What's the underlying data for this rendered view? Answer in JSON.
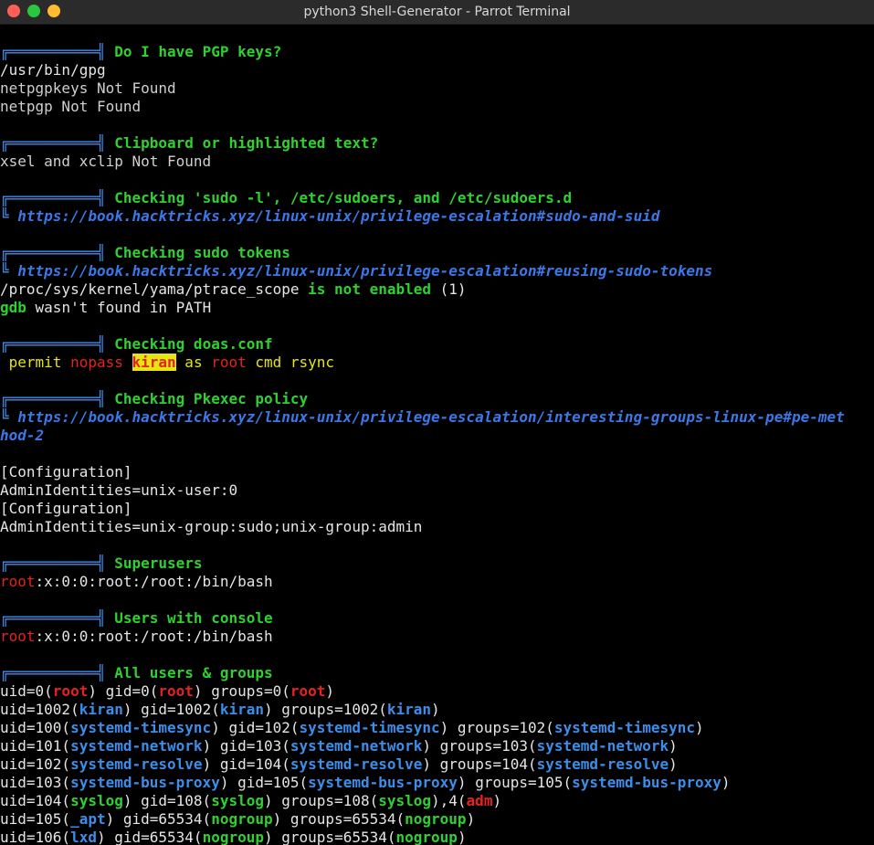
{
  "window": {
    "title": "python3 Shell-Generator - Parrot Terminal"
  },
  "banner": "╔══════════╣ ",
  "sub": "╚ ",
  "sections": {
    "pgp": {
      "title": "Do I have PGP keys?",
      "lines": [
        "/usr/bin/gpg",
        "netpgpkeys Not Found",
        "netpgp Not Found"
      ]
    },
    "clipboard": {
      "title": "Clipboard or highlighted text?",
      "lines": [
        "xsel and xclip Not Found"
      ]
    },
    "sudo": {
      "title": "Checking 'sudo -l', /etc/sudoers, and /etc/sudoers.d",
      "url": "https://book.hacktricks.xyz/linux-unix/privilege-escalation#sudo-and-suid"
    },
    "tokens": {
      "title": "Checking sudo tokens",
      "url": "https://book.hacktricks.xyz/linux-unix/privilege-escalation#reusing-sudo-tokens",
      "ptrace_path": "/proc/sys/kernel/yama/ptrace_scope",
      "ptrace_status": " is not enabled",
      "ptrace_value": " (1)",
      "gdb": "gdb",
      "gdb_rest": " wasn't found in PATH"
    },
    "doas": {
      "title": "Checking doas.conf",
      "permit": " permit ",
      "nopass": "nopass",
      "space": " ",
      "user": "kiran",
      "as": " as ",
      "root": "root",
      "rest": " cmd rsync"
    },
    "pkexec": {
      "title": "Checking Pkexec policy",
      "url1": "https://book.hacktricks.xyz/linux-unix/privilege-escalation/interesting-groups-linux-pe#pe-met",
      "url2": "hod-2",
      "lines": [
        "[Configuration]",
        "AdminIdentities=unix-user:0",
        "[Configuration]",
        "AdminIdentities=unix-group:sudo;unix-group:admin"
      ]
    },
    "superusers": {
      "title": "Superusers",
      "root": "root",
      "rest": ":x:0:0:root:/root:/bin/bash"
    },
    "console": {
      "title": "Users with console",
      "root": "root",
      "rest": ":x:0:0:root:/root:/bin/bash"
    },
    "allusers": {
      "title": "All users & groups"
    }
  },
  "users": [
    [
      [
        "uid=0(",
        ""
      ],
      [
        "root",
        "r"
      ],
      [
        ") gid=0(",
        ""
      ],
      [
        "root",
        "r"
      ],
      [
        ") groups=0(",
        ""
      ],
      [
        "root",
        "r"
      ],
      [
        ")",
        ""
      ]
    ],
    [
      [
        "uid=1002(",
        ""
      ],
      [
        "kiran",
        "b"
      ],
      [
        ") gid=1002(",
        ""
      ],
      [
        "kiran",
        "b"
      ],
      [
        ") groups=1002(",
        ""
      ],
      [
        "kiran",
        "b"
      ],
      [
        ")",
        ""
      ]
    ],
    [
      [
        "uid=100(",
        ""
      ],
      [
        "systemd-timesync",
        "b"
      ],
      [
        ") gid=102(",
        ""
      ],
      [
        "systemd-timesync",
        "b"
      ],
      [
        ") groups=102(",
        ""
      ],
      [
        "systemd-timesync",
        "b"
      ],
      [
        ")",
        ""
      ]
    ],
    [
      [
        "uid=101(",
        ""
      ],
      [
        "systemd-network",
        "b"
      ],
      [
        ") gid=103(",
        ""
      ],
      [
        "systemd-network",
        "b"
      ],
      [
        ") groups=103(",
        ""
      ],
      [
        "systemd-network",
        "b"
      ],
      [
        ")",
        ""
      ]
    ],
    [
      [
        "uid=102(",
        ""
      ],
      [
        "systemd-resolve",
        "b"
      ],
      [
        ") gid=104(",
        ""
      ],
      [
        "systemd-resolve",
        "b"
      ],
      [
        ") groups=104(",
        ""
      ],
      [
        "systemd-resolve",
        "b"
      ],
      [
        ")",
        ""
      ]
    ],
    [
      [
        "uid=103(",
        ""
      ],
      [
        "systemd-bus-proxy",
        "b"
      ],
      [
        ") gid=105(",
        ""
      ],
      [
        "systemd-bus-proxy",
        "b"
      ],
      [
        ") groups=105(",
        ""
      ],
      [
        "systemd-bus-proxy",
        "b"
      ],
      [
        ")",
        ""
      ]
    ],
    [
      [
        "uid=104(",
        ""
      ],
      [
        "syslog",
        "g"
      ],
      [
        ") gid=108(",
        ""
      ],
      [
        "syslog",
        "g"
      ],
      [
        ") groups=108(",
        ""
      ],
      [
        "syslog",
        "g"
      ],
      [
        "),4(",
        ""
      ],
      [
        "adm",
        "r"
      ],
      [
        ")",
        ""
      ]
    ],
    [
      [
        "uid=105(",
        ""
      ],
      [
        "_apt",
        "b"
      ],
      [
        ") gid=65534(",
        ""
      ],
      [
        "nogroup",
        "g"
      ],
      [
        ") groups=65534(",
        ""
      ],
      [
        "nogroup",
        "g"
      ],
      [
        ")",
        ""
      ]
    ],
    [
      [
        "uid=106(",
        ""
      ],
      [
        "lxd",
        "b"
      ],
      [
        ") gid=65534(",
        ""
      ],
      [
        "nogroup",
        "g"
      ],
      [
        ") groups=65534(",
        ""
      ],
      [
        "nogroup",
        "g"
      ],
      [
        ")",
        ""
      ]
    ]
  ]
}
